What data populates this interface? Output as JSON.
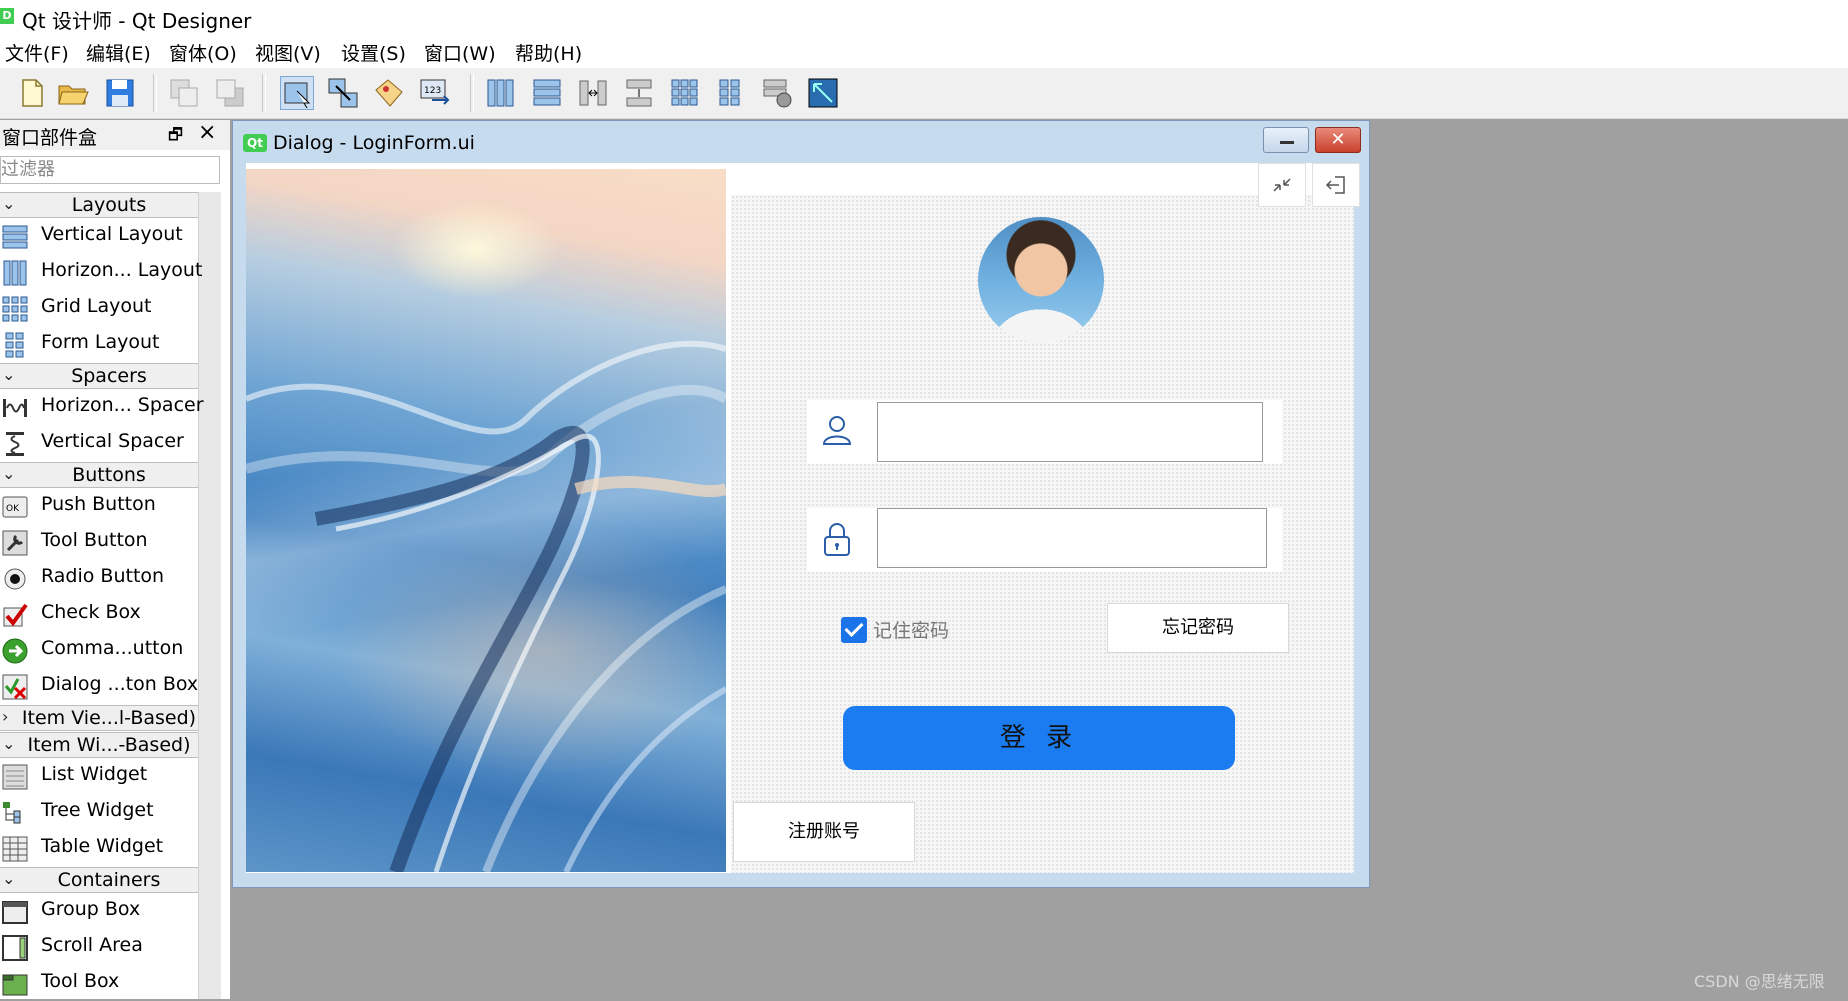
{
  "app": {
    "title": "Qt 设计师 - Qt Designer",
    "icon_letter": "D"
  },
  "menu": [
    "文件(F)",
    "编辑(E)",
    "窗体(O)",
    "视图(V)",
    "设置(S)",
    "窗口(W)",
    "帮助(H)"
  ],
  "widget_box": {
    "title": "窗口部件盒",
    "filter_placeholder": "过滤器",
    "categories": [
      {
        "label": "Layouts",
        "expanded": true,
        "items": [
          "Vertical Layout",
          "Horizon... Layout",
          "Grid Layout",
          "Form Layout"
        ]
      },
      {
        "label": "Spacers",
        "expanded": true,
        "items": [
          "Horizon... Spacer",
          "Vertical Spacer"
        ]
      },
      {
        "label": "Buttons",
        "expanded": true,
        "items": [
          "Push Button",
          "Tool Button",
          "Radio Button",
          "Check Box",
          "Comma...utton",
          "Dialog ...ton Box"
        ]
      },
      {
        "label": "Item Vie...l-Based)",
        "expanded": false,
        "items": []
      },
      {
        "label": "Item Wi...-Based)",
        "expanded": true,
        "items": [
          "List Widget",
          "Tree Widget",
          "Table Widget"
        ]
      },
      {
        "label": "Containers",
        "expanded": true,
        "items": [
          "Group Box",
          "Scroll Area",
          "Tool Box"
        ]
      }
    ]
  },
  "dialog": {
    "badge": "Qt",
    "title": "Dialog - LoginForm.ui",
    "close_glyph": "✕"
  },
  "login_form": {
    "username_value": "",
    "password_value": "",
    "remember_label": "记住密码",
    "remember_checked": true,
    "forgot_label": "忘记密码",
    "login_label": "登 录",
    "register_label": "注册账号",
    "accent_color": "#1a7cf0"
  },
  "watermark": "CSDN @思绪无限"
}
